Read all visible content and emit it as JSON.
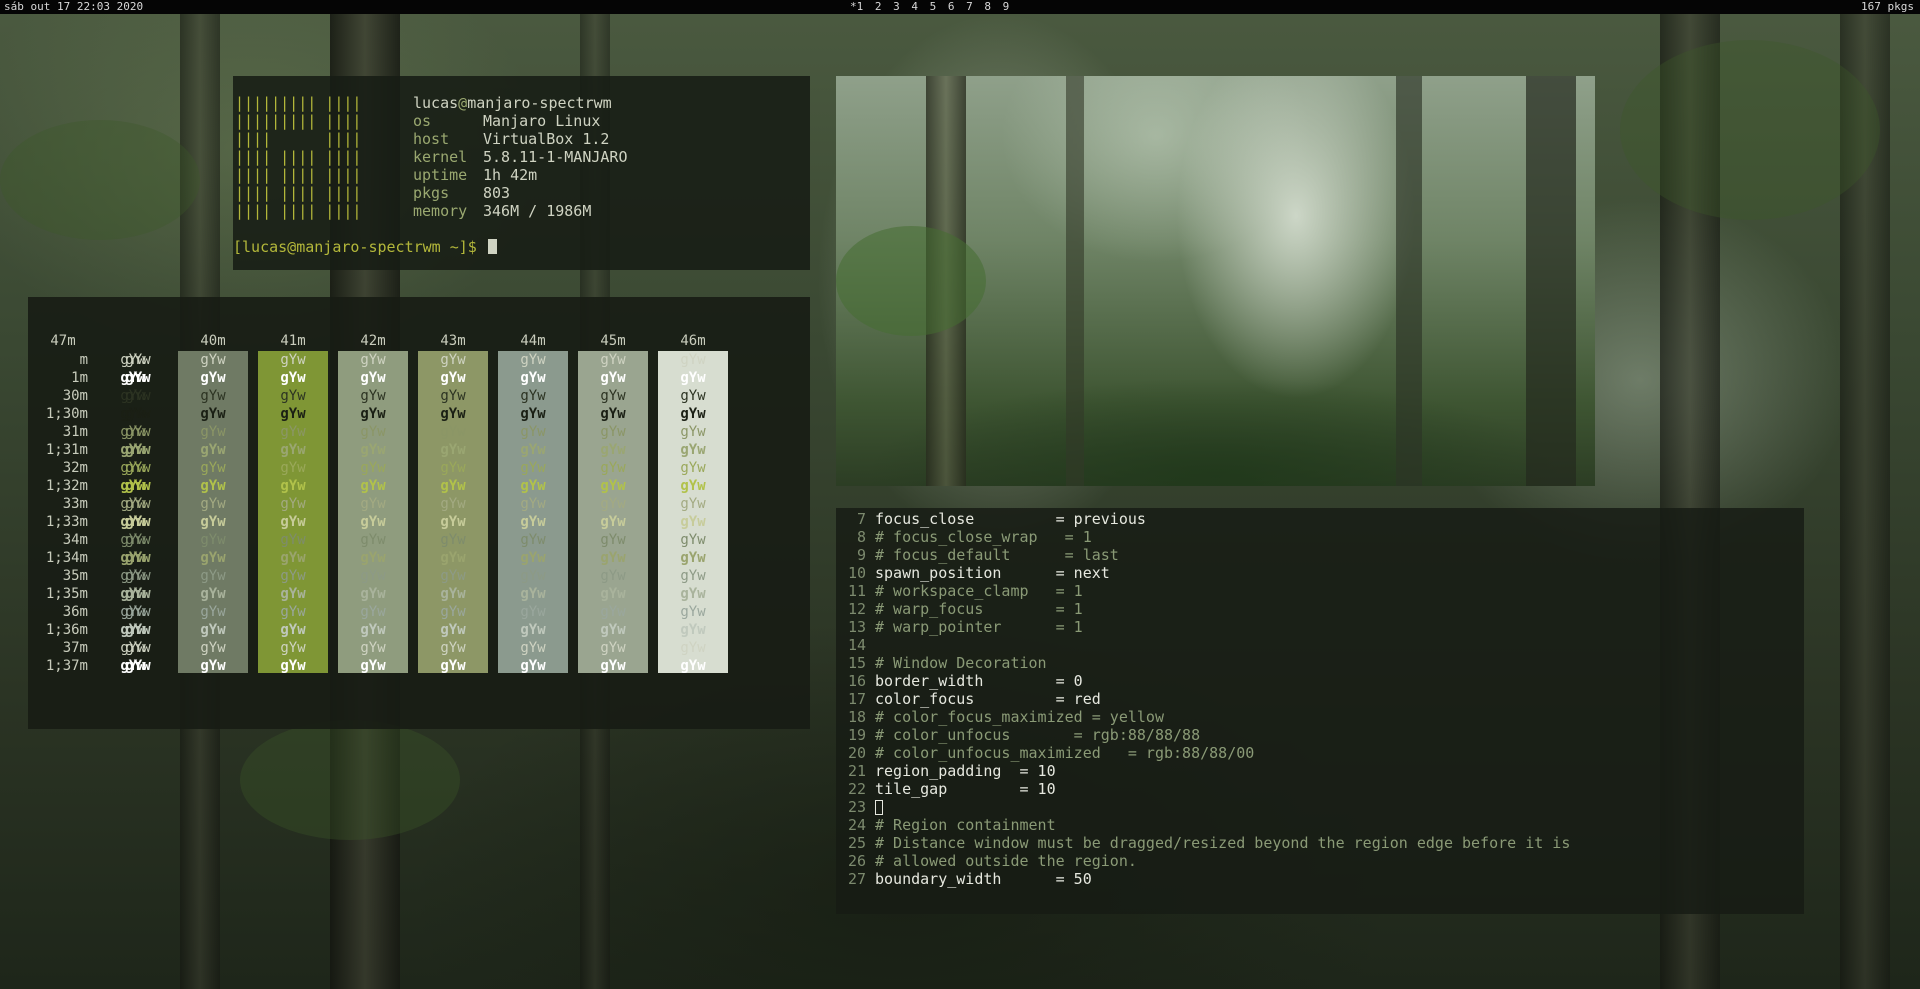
{
  "bar": {
    "clock": "sáb out 17 22:03 2020",
    "workspaces": "*1 2 3 4 5 6 7 8 9",
    "pkgs": "167 pkgs"
  },
  "fetch": {
    "logo": [
      "||||||||| ||||",
      "||||||||| ||||",
      "||||      ||||",
      "|||| |||| ||||",
      "|||| |||| ||||",
      "|||| |||| ||||",
      "|||| |||| ||||"
    ],
    "user": "lucas",
    "at": "@",
    "host_name": "manjaro-spectrwm",
    "info": [
      {
        "key": "os",
        "value": "Manjaro Linux"
      },
      {
        "key": "host",
        "value": "VirtualBox 1.2"
      },
      {
        "key": "kernel",
        "value": "5.8.11-1-MANJARO"
      },
      {
        "key": "uptime",
        "value": "1h 42m"
      },
      {
        "key": "pkgs",
        "value": "803"
      },
      {
        "key": "memory",
        "value": "346M / 1986M"
      }
    ],
    "prompt": "[lucas@manjaro-spectrwm ~]$ "
  },
  "colors": {
    "headers": [
      "40m",
      "41m",
      "42m",
      "43m",
      "44m",
      "45m",
      "46m",
      "47m"
    ],
    "rows": [
      "m",
      "1m",
      "30m",
      "1;30m",
      "31m",
      "1;31m",
      "32m",
      "1;32m",
      "33m",
      "1;33m",
      "34m",
      "1;34m",
      "35m",
      "1;35m",
      "36m",
      "1;36m",
      "37m",
      "1;37m"
    ],
    "sample": "gYw",
    "bg_colors": [
      "#6f7a64",
      "#7f9635",
      "#8f9c7e",
      "#8d9766",
      "#8b9a8e",
      "#9aa590",
      "#d7ddd0"
    ],
    "fg_colors": [
      "#cfd3c2",
      "#ffffff",
      "#2c3322",
      "#1a1f14",
      "#8b9666",
      "#9aa672",
      "#9aa85a",
      "#b1c24a",
      "#a3aa82",
      "#c7cc9a",
      "#7e8c6c",
      "#9aa46e",
      "#8d9a86",
      "#a9b39c",
      "#9aa79d",
      "#c0c9bd",
      "#cfd3c2",
      "#ffffff"
    ]
  },
  "editor": {
    "lines": [
      {
        "n": "7",
        "text": "focus_close         = previous",
        "c": false
      },
      {
        "n": "8",
        "text": "# focus_close_wrap   = 1",
        "c": true
      },
      {
        "n": "9",
        "text": "# focus_default      = last",
        "c": true
      },
      {
        "n": "10",
        "text": "spawn_position      = next",
        "c": false
      },
      {
        "n": "11",
        "text": "# workspace_clamp   = 1",
        "c": true
      },
      {
        "n": "12",
        "text": "# warp_focus        = 1",
        "c": true
      },
      {
        "n": "13",
        "text": "# warp_pointer      = 1",
        "c": true
      },
      {
        "n": "14",
        "text": "",
        "c": false
      },
      {
        "n": "15",
        "text": "# Window Decoration",
        "c": true
      },
      {
        "n": "16",
        "text": "border_width        = 0",
        "c": false
      },
      {
        "n": "17",
        "text": "color_focus         = red",
        "c": false
      },
      {
        "n": "18",
        "text": "# color_focus_maximized = yellow",
        "c": true
      },
      {
        "n": "19",
        "text": "# color_unfocus       = rgb:88/88/88",
        "c": true
      },
      {
        "n": "20",
        "text": "# color_unfocus_maximized   = rgb:88/88/00",
        "c": true
      },
      {
        "n": "21",
        "text": "region_padding  = 10",
        "c": false
      },
      {
        "n": "22",
        "text": "tile_gap        = 10",
        "c": false
      },
      {
        "n": "23",
        "text": "",
        "c": false,
        "cursor": true
      },
      {
        "n": "24",
        "text": "# Region containment",
        "c": true
      },
      {
        "n": "25",
        "text": "# Distance window must be dragged/resized beyond the region edge before it is",
        "c": true
      },
      {
        "n": "26",
        "text": "# allowed outside the region.",
        "c": true
      },
      {
        "n": "27",
        "text": "boundary_width      = 50",
        "c": false
      }
    ]
  }
}
